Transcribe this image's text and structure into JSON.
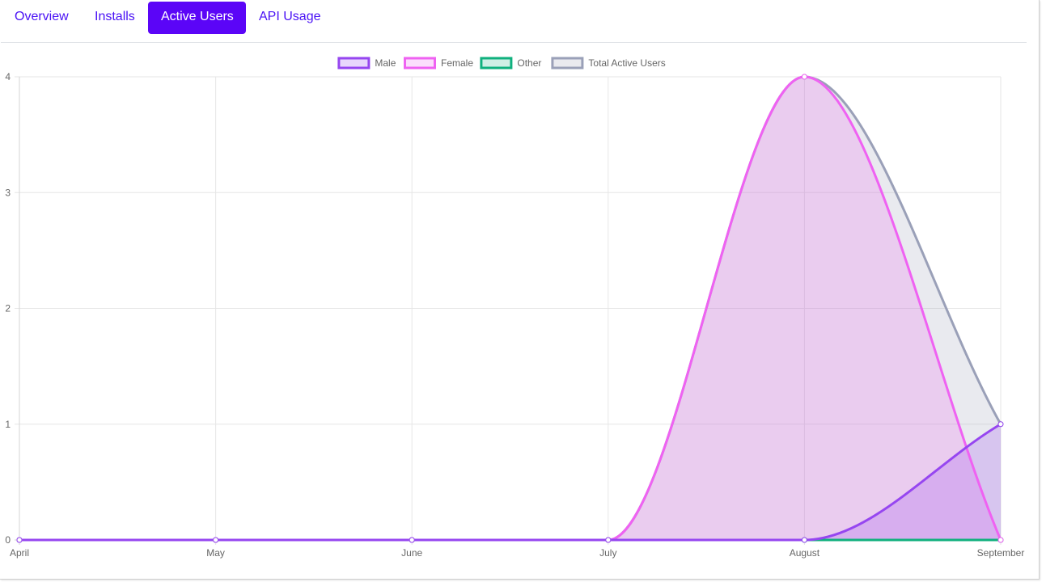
{
  "tabs": [
    {
      "label": "Overview"
    },
    {
      "label": "Installs"
    },
    {
      "label": "Active Users",
      "active": true
    },
    {
      "label": "API Usage"
    }
  ],
  "colors": {
    "accent": "#5b05f7",
    "tab_text": "#4a12f5"
  },
  "chart_data": {
    "type": "area",
    "categories": [
      "April",
      "May",
      "June",
      "July",
      "August",
      "September"
    ],
    "series": [
      {
        "name": "Male",
        "values": [
          0,
          0,
          0,
          0,
          0,
          1
        ],
        "stroke": "#9646f0",
        "fill": "rgba(150,70,240,0.22)"
      },
      {
        "name": "Female",
        "values": [
          0,
          0,
          0,
          0,
          4,
          0
        ],
        "stroke": "#ef62f2",
        "fill": "rgba(239,98,242,0.22)"
      },
      {
        "name": "Other",
        "values": [
          0,
          0,
          0,
          0,
          0,
          0
        ],
        "stroke": "#10b07e",
        "fill": "rgba(16,176,126,0.20)"
      },
      {
        "name": "Total Active Users",
        "values": [
          0,
          0,
          0,
          0,
          4,
          1
        ],
        "stroke": "#9aa0b8",
        "fill": "rgba(154,160,184,0.22)"
      }
    ],
    "ylim": [
      0,
      4
    ],
    "yticks": [
      "0",
      "1",
      "2",
      "3",
      "4"
    ],
    "grid": true,
    "legend": "top-center"
  }
}
